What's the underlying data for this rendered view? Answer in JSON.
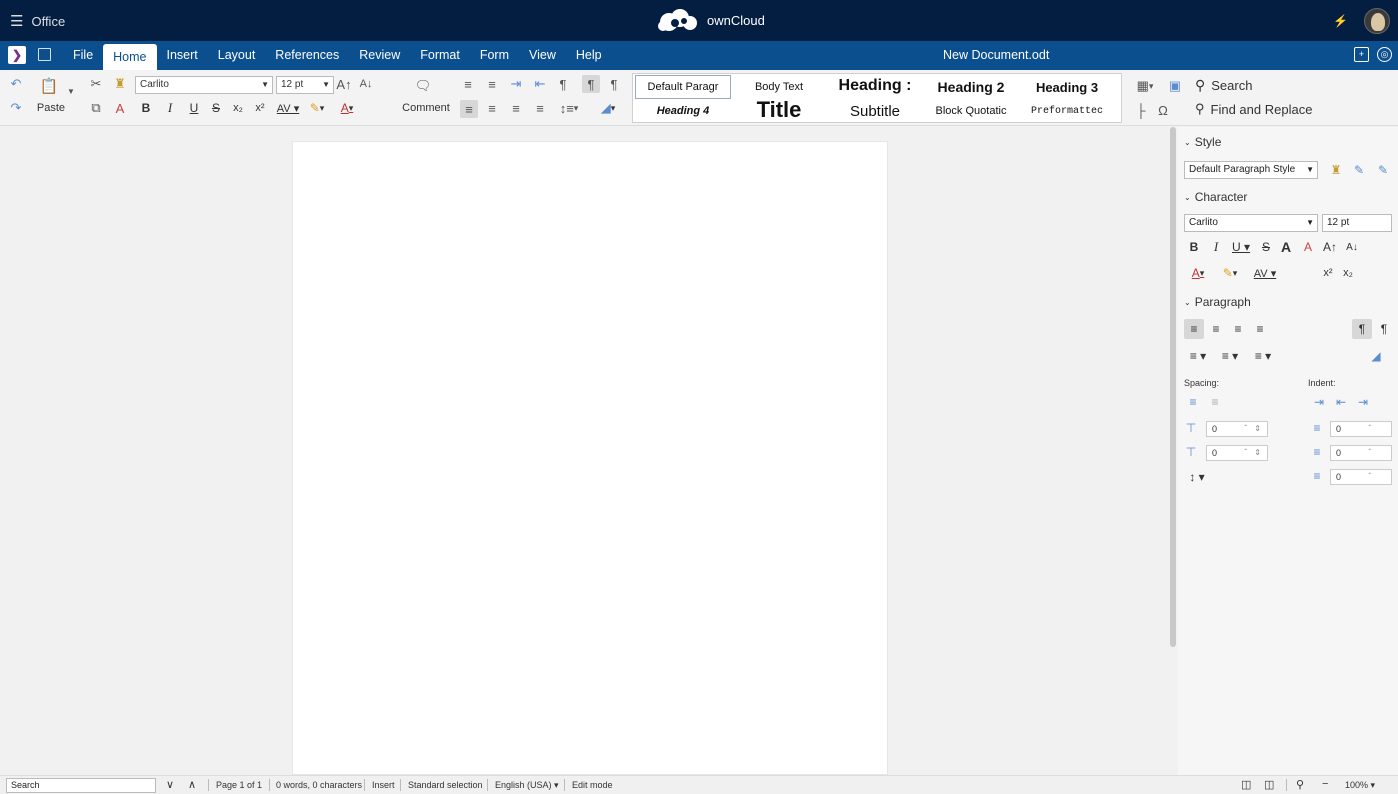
{
  "topbar": {
    "menu_label": "Office",
    "brand": "ownCloud"
  },
  "menubar": {
    "tabs": [
      "File",
      "Home",
      "Insert",
      "Layout",
      "References",
      "Review",
      "Format",
      "Form",
      "View",
      "Help"
    ],
    "active_tab": "Home",
    "document_name": "New Document.odt"
  },
  "toolbar": {
    "paste_label": "Paste",
    "comment_label": "Comment",
    "font_name": "Carlito",
    "font_size": "12 pt",
    "styles": [
      "Default Paragr",
      "Body Text",
      "Heading :",
      "Heading 2",
      "Heading 3",
      "Heading 4",
      "Title",
      "Subtitle",
      "Block Quotatic",
      "Preformattec"
    ],
    "search_label": "Search",
    "find_replace_label": "Find and Replace"
  },
  "sidebar": {
    "style_header": "Style",
    "paragraph_style": "Default Paragraph Style",
    "character_header": "Character",
    "font_name": "Carlito",
    "font_size": "12 pt",
    "paragraph_header": "Paragraph",
    "spacing_label": "Spacing:",
    "indent_label": "Indent:",
    "spin_values": [
      "0",
      "0",
      "0",
      "0",
      "0"
    ]
  },
  "statusbar": {
    "search_value": "Search",
    "page": "Page 1 of 1",
    "words": "0 words, 0 characters",
    "insert_mode": "Insert",
    "selection": "Standard selection",
    "language": "English (USA)",
    "edit_mode": "Edit mode",
    "zoom": "100%"
  },
  "colors": {
    "topbar_bg": "#041e42",
    "menubar_bg": "#0b4f8f",
    "accent": "#0b4f8f"
  }
}
